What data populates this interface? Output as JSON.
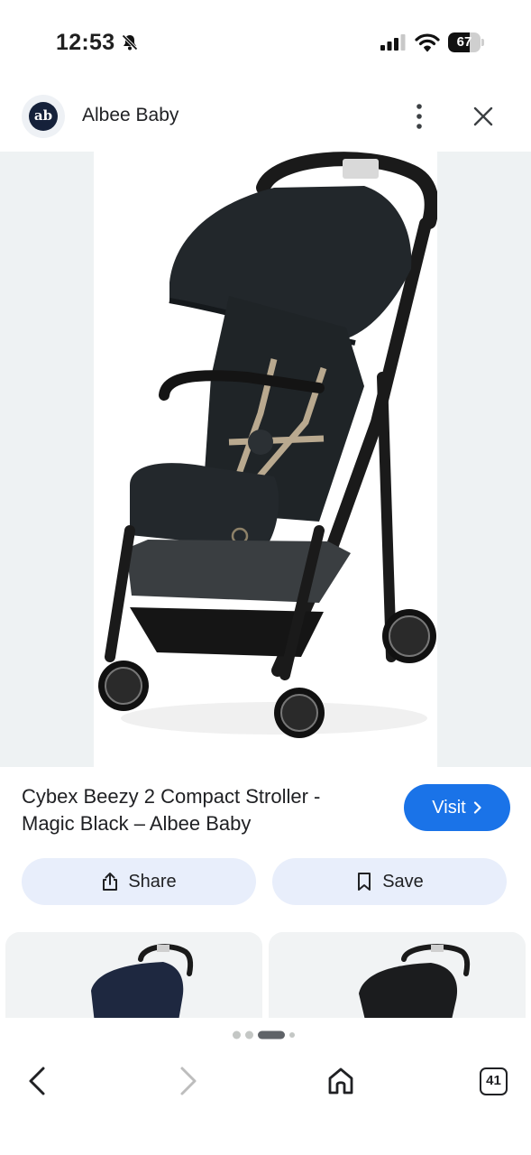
{
  "status_bar": {
    "time": "12:53",
    "battery_level": "67",
    "icons": [
      "bell-slash-icon",
      "cellular-signal-icon",
      "wifi-icon",
      "battery-icon"
    ]
  },
  "header": {
    "avatar_text": "ab",
    "site_name": "Albee Baby",
    "icons": [
      "more-vertical-icon",
      "close-icon"
    ]
  },
  "product": {
    "image": "stroller-image",
    "title_line1": "Cybex Beezy 2 Compact Stroller -",
    "title_line2": "Magic Black – Albee Baby",
    "visit_label": "Visit"
  },
  "actions": {
    "share_label": "Share",
    "save_label": "Save"
  },
  "related": {
    "cards": [
      "related-stroller-1",
      "related-stroller-2"
    ]
  },
  "bottom_nav": {
    "tab_count": "41",
    "page_dots": 4,
    "active_dot": 2,
    "icons": [
      "back-icon",
      "forward-icon",
      "home-icon",
      "tabs-icon"
    ]
  },
  "colors": {
    "accent": "#1a73e8",
    "pill_background": "#e8eefb",
    "image_backdrop": "#eef2f3"
  }
}
